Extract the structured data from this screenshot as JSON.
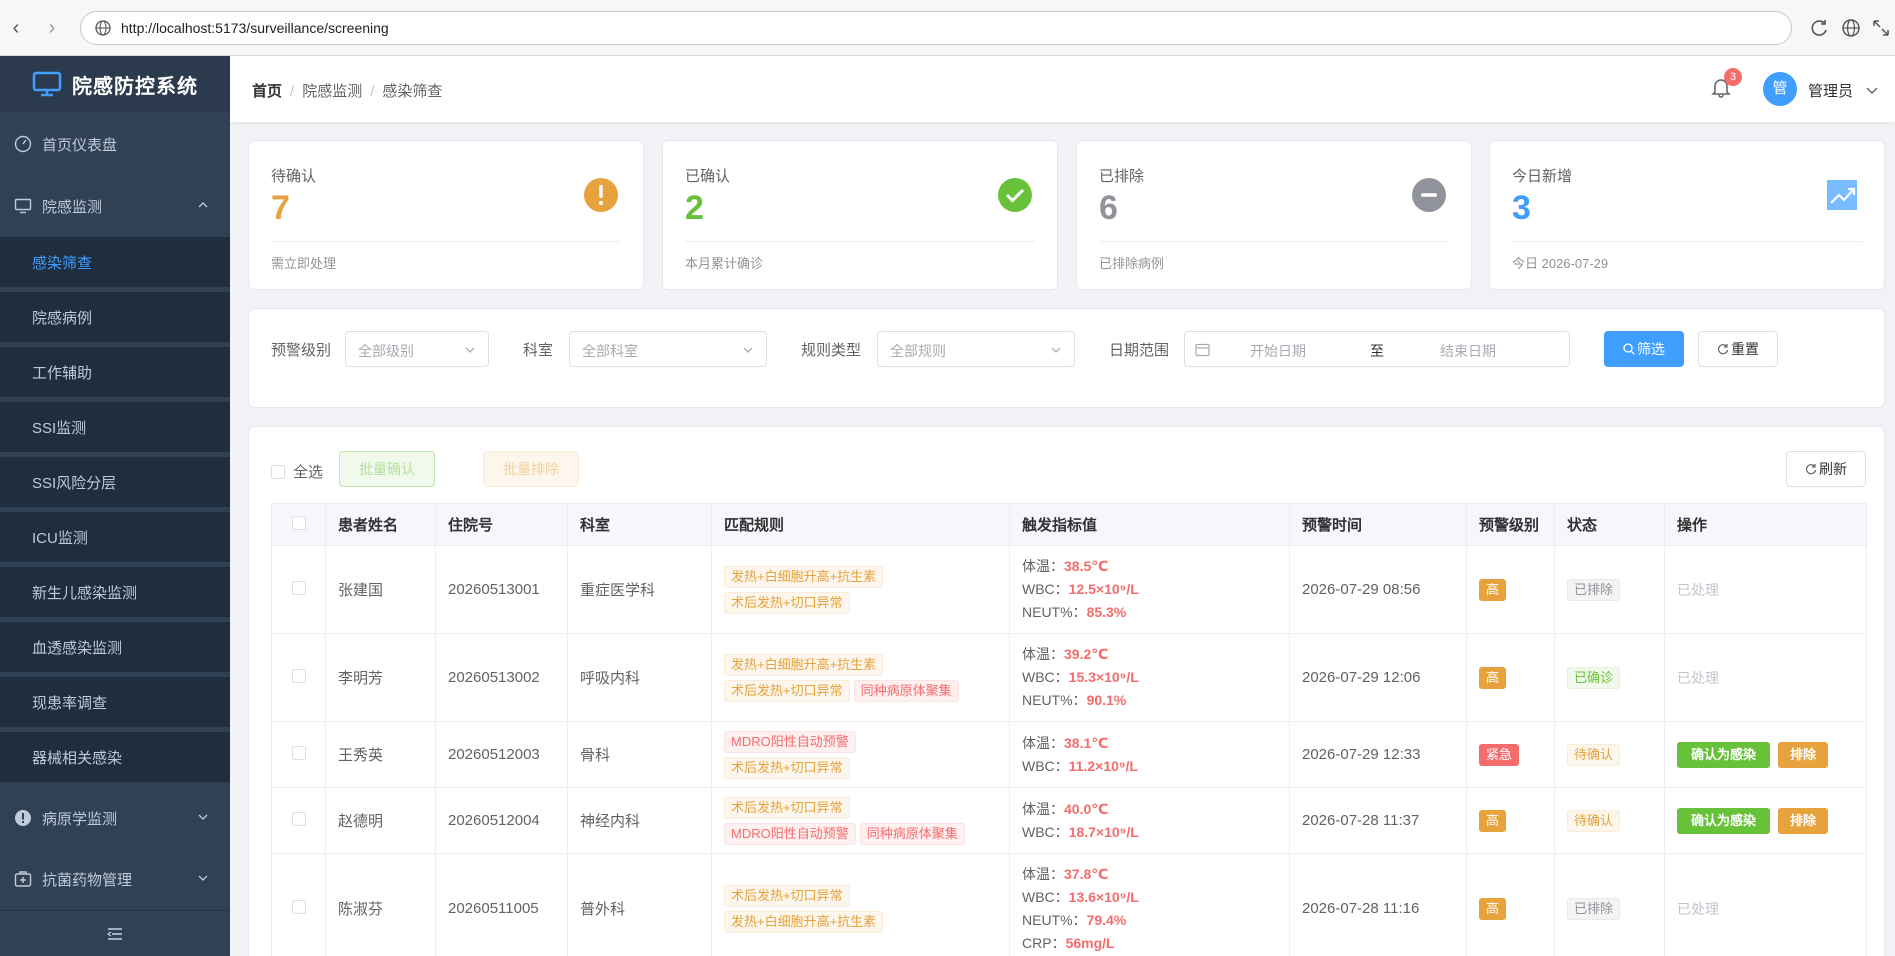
{
  "browser": {
    "url": "http://localhost:5173/surveillance/screening"
  },
  "sidebar": {
    "logo": "院感防控系统",
    "items": [
      {
        "label": "首页仪表盘",
        "icon": "dashboard-icon"
      },
      {
        "label": "院感监测",
        "icon": "monitor-icon",
        "expanded": true,
        "children": [
          "感染筛查",
          "院感病例",
          "工作辅助",
          "SSI监测",
          "SSI风险分层",
          "ICU监测",
          "新生儿感染监测",
          "血透感染监测",
          "现患率调查",
          "器械相关感染"
        ]
      },
      {
        "label": "病原学监测",
        "icon": "alert-circle-icon"
      },
      {
        "label": "抗菌药物管理",
        "icon": "medkit-icon"
      }
    ],
    "active": "感染筛查"
  },
  "header": {
    "breadcrumb": [
      "首页",
      "院感监测",
      "感染筛查"
    ],
    "notifications": "3",
    "avatar": "管",
    "user": "管理员"
  },
  "stats": [
    {
      "title": "待确认",
      "value": "7",
      "sub": "需立即处理",
      "color": "#e6a23c",
      "icon": "warning-icon"
    },
    {
      "title": "已确认",
      "value": "2",
      "sub": "本月累计确诊",
      "color": "#67c23a",
      "icon": "check-circle-icon"
    },
    {
      "title": "已排除",
      "value": "6",
      "sub": "已排除病例",
      "color": "#909399",
      "icon": "minus-circle-icon"
    },
    {
      "title": "今日新增",
      "value": "3",
      "sub": "今日 2026-07-29",
      "color": "#409eff",
      "icon": "trend-icon"
    }
  ],
  "filters": {
    "level_label": "预警级别",
    "level_placeholder": "全部级别",
    "dept_label": "科室",
    "dept_placeholder": "全部科室",
    "rule_label": "规则类型",
    "rule_placeholder": "全部规则",
    "date_label": "日期范围",
    "date_start": "开始日期",
    "date_to": "至",
    "date_end": "结束日期",
    "search": "筛选",
    "reset": "重置"
  },
  "toolbar": {
    "select_all": "全选",
    "batch_confirm": "批量确认",
    "batch_exclude": "批量排除",
    "refresh": "刷新"
  },
  "table": {
    "columns": [
      "患者姓名",
      "住院号",
      "科室",
      "匹配规则",
      "触发指标值",
      "预警时间",
      "预警级别",
      "状态",
      "操作"
    ],
    "rows": [
      {
        "name": "张建国",
        "id": "20260513001",
        "dept": "重症医学科",
        "rules": [
          {
            "t": "发热+白细胞升高+抗生素",
            "c": "warn"
          },
          {
            "t": "术后发热+切口异常",
            "c": "warn"
          }
        ],
        "indicators": [
          {
            "k": "体温：",
            "v": "38.5℃"
          },
          {
            "k": "WBC：",
            "v": "12.5×10⁹/L"
          },
          {
            "k": "NEUT%：",
            "v": "85.3%"
          }
        ],
        "time": "2026-07-29 08:56",
        "level": "高",
        "level_c": "solid-warn",
        "status": "已排除",
        "status_c": "info",
        "action": "已处理"
      },
      {
        "name": "李明芳",
        "id": "20260513002",
        "dept": "呼吸内科",
        "rules": [
          {
            "t": "发热+白细胞升高+抗生素",
            "c": "warn"
          },
          {
            "t": "术后发热+切口异常",
            "c": "warn"
          },
          {
            "t": "同种病原体聚集",
            "c": "danger"
          }
        ],
        "indicators": [
          {
            "k": "体温：",
            "v": "39.2℃"
          },
          {
            "k": "WBC：",
            "v": "15.3×10⁹/L"
          },
          {
            "k": "NEUT%：",
            "v": "90.1%"
          }
        ],
        "time": "2026-07-29 12:06",
        "level": "高",
        "level_c": "solid-warn",
        "status": "已确诊",
        "status_c": "success",
        "action": "已处理"
      },
      {
        "name": "王秀英",
        "id": "20260512003",
        "dept": "骨科",
        "rules": [
          {
            "t": "MDRO阳性自动预警",
            "c": "danger"
          },
          {
            "t": "术后发热+切口异常",
            "c": "warn"
          }
        ],
        "indicators": [
          {
            "k": "体温：",
            "v": "38.1℃"
          },
          {
            "k": "WBC：",
            "v": "11.2×10⁹/L"
          }
        ],
        "time": "2026-07-29 12:33",
        "level": "紧急",
        "level_c": "solid-danger",
        "status": "待确认",
        "status_c": "warn",
        "action": "buttons"
      },
      {
        "name": "赵德明",
        "id": "20260512004",
        "dept": "神经内科",
        "rules": [
          {
            "t": "术后发热+切口异常",
            "c": "warn"
          },
          {
            "t": "MDRO阳性自动预警",
            "c": "danger"
          },
          {
            "t": "同种病原体聚集",
            "c": "danger"
          }
        ],
        "indicators": [
          {
            "k": "体温：",
            "v": "40.0℃"
          },
          {
            "k": "WBC：",
            "v": "18.7×10⁹/L"
          }
        ],
        "time": "2026-07-28 11:37",
        "level": "高",
        "level_c": "solid-warn",
        "status": "待确认",
        "status_c": "warn",
        "action": "buttons"
      },
      {
        "name": "陈淑芬",
        "id": "20260511005",
        "dept": "普外科",
        "rules": [
          {
            "t": "术后发热+切口异常",
            "c": "warn"
          },
          {
            "t": "发热+白细胞升高+抗生素",
            "c": "warn"
          }
        ],
        "indicators": [
          {
            "k": "体温：",
            "v": "37.8℃"
          },
          {
            "k": "WBC：",
            "v": "13.6×10⁹/L"
          },
          {
            "k": "NEUT%：",
            "v": "79.4%"
          },
          {
            "k": "CRP：",
            "v": "56mg/L"
          }
        ],
        "time": "2026-07-28 11:16",
        "level": "高",
        "level_c": "solid-warn",
        "status": "已排除",
        "status_c": "info",
        "action": "已处理"
      }
    ],
    "confirm_label": "确认为感染",
    "exclude_label": "排除"
  }
}
